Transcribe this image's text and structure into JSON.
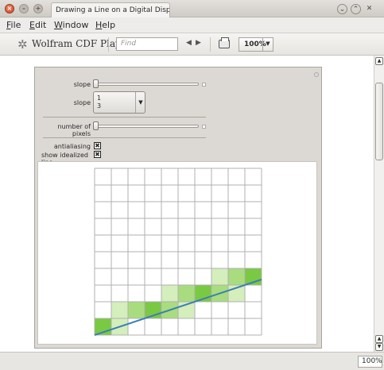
{
  "window": {
    "tab_title": "Drawing a Line on a Digital Display",
    "close_glyph": "×",
    "min_glyph": "–",
    "max_glyph": "+"
  },
  "menu": {
    "items": [
      {
        "label": "File",
        "accel": "F",
        "rest": "ile"
      },
      {
        "label": "Edit",
        "accel": "E",
        "rest": "dit"
      },
      {
        "label": "Window",
        "accel": "W",
        "rest": "indow"
      },
      {
        "label": "Help",
        "accel": "H",
        "rest": "elp"
      }
    ]
  },
  "toolbar": {
    "logo_text": "Wolfram CDF Player",
    "find_placeholder": "Find",
    "prev_glyph": "◀",
    "next_glyph": "▶",
    "zoom_value": "100%"
  },
  "panel": {
    "slope_label": "slope",
    "slope_slider_value": 0.333,
    "slope_popup_label": "slope",
    "slope_numerator": "1",
    "slope_denominator": "3",
    "pixels_label": "number of pixels",
    "pixels_slider_value": 0.0,
    "antialiasing_label": "antialiasing",
    "antialiasing_checked": "✖",
    "idealized_label": "show idealized line",
    "idealized_checked": "✖"
  },
  "plot": {
    "grid_cols": 10,
    "grid_rows": 10,
    "line_color": "#3a7fb3",
    "pixel_colors": {
      "strong": "#7ac943",
      "medium": "#a9dc7e",
      "light": "#d4eebc"
    },
    "pixels": [
      {
        "col": 0,
        "row": 9,
        "tone": "strong"
      },
      {
        "col": 1,
        "row": 9,
        "tone": "light"
      },
      {
        "col": 1,
        "row": 8,
        "tone": "light"
      },
      {
        "col": 2,
        "row": 8,
        "tone": "medium"
      },
      {
        "col": 3,
        "row": 8,
        "tone": "strong"
      },
      {
        "col": 4,
        "row": 8,
        "tone": "medium"
      },
      {
        "col": 5,
        "row": 8,
        "tone": "light"
      },
      {
        "col": 4,
        "row": 7,
        "tone": "light"
      },
      {
        "col": 5,
        "row": 7,
        "tone": "medium"
      },
      {
        "col": 6,
        "row": 7,
        "tone": "strong"
      },
      {
        "col": 7,
        "row": 7,
        "tone": "medium"
      },
      {
        "col": 8,
        "row": 7,
        "tone": "light"
      },
      {
        "col": 7,
        "row": 6,
        "tone": "light"
      },
      {
        "col": 8,
        "row": 6,
        "tone": "medium"
      },
      {
        "col": 9,
        "row": 6,
        "tone": "strong"
      }
    ]
  },
  "status": {
    "zoom_value": "100%"
  }
}
